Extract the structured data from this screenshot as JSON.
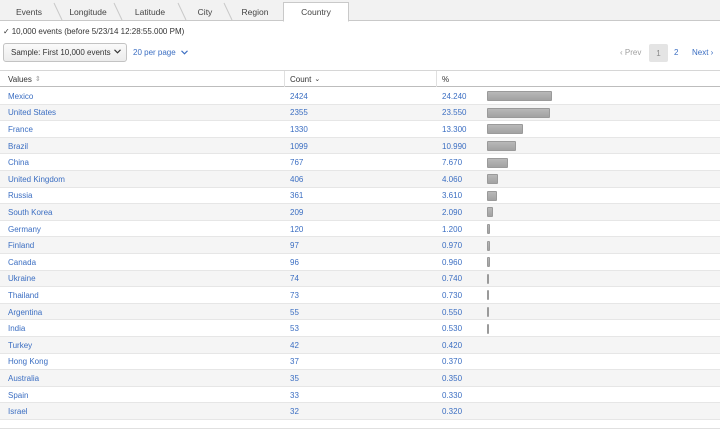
{
  "tabs": [
    {
      "label": "Events",
      "active": false
    },
    {
      "label": "Longitude",
      "active": false
    },
    {
      "label": "Latitude",
      "active": false
    },
    {
      "label": "City",
      "active": false
    },
    {
      "label": "Region",
      "active": false
    },
    {
      "label": "Country",
      "active": true
    }
  ],
  "status": {
    "check": "✓",
    "text": "10,000 events (before 5/23/14 12:28:55.000 PM)"
  },
  "controls": {
    "sample_label": "Sample: First 10,000 events",
    "per_page_label": "20 per page"
  },
  "pager": {
    "prev": "‹ Prev",
    "pages": [
      "1",
      "2"
    ],
    "current": "1",
    "next": "Next ›"
  },
  "table": {
    "headers": {
      "values": "Values",
      "count": "Count",
      "percent": "%"
    },
    "rows": [
      {
        "value": "Mexico",
        "count": "2424",
        "percent": "24.240"
      },
      {
        "value": "United States",
        "count": "2355",
        "percent": "23.550"
      },
      {
        "value": "France",
        "count": "1330",
        "percent": "13.300"
      },
      {
        "value": "Brazil",
        "count": "1099",
        "percent": "10.990"
      },
      {
        "value": "China",
        "count": "767",
        "percent": "7.670"
      },
      {
        "value": "United Kingdom",
        "count": "406",
        "percent": "4.060"
      },
      {
        "value": "Russia",
        "count": "361",
        "percent": "3.610"
      },
      {
        "value": "South Korea",
        "count": "209",
        "percent": "2.090"
      },
      {
        "value": "Germany",
        "count": "120",
        "percent": "1.200"
      },
      {
        "value": "Finland",
        "count": "97",
        "percent": "0.970"
      },
      {
        "value": "Canada",
        "count": "96",
        "percent": "0.960"
      },
      {
        "value": "Ukraine",
        "count": "74",
        "percent": "0.740"
      },
      {
        "value": "Thailand",
        "count": "73",
        "percent": "0.730"
      },
      {
        "value": "Argentina",
        "count": "55",
        "percent": "0.550"
      },
      {
        "value": "India",
        "count": "53",
        "percent": "0.530"
      },
      {
        "value": "Turkey",
        "count": "42",
        "percent": "0.420"
      },
      {
        "value": "Hong Kong",
        "count": "37",
        "percent": "0.370"
      },
      {
        "value": "Australia",
        "count": "35",
        "percent": "0.350"
      },
      {
        "value": "Spain",
        "count": "33",
        "percent": "0.330"
      },
      {
        "value": "Israel",
        "count": "32",
        "percent": "0.320"
      }
    ]
  },
  "colors": {
    "link": "#3b6ec2",
    "bar": "#a8a8a8",
    "row_alt": "#f5f5f5"
  }
}
